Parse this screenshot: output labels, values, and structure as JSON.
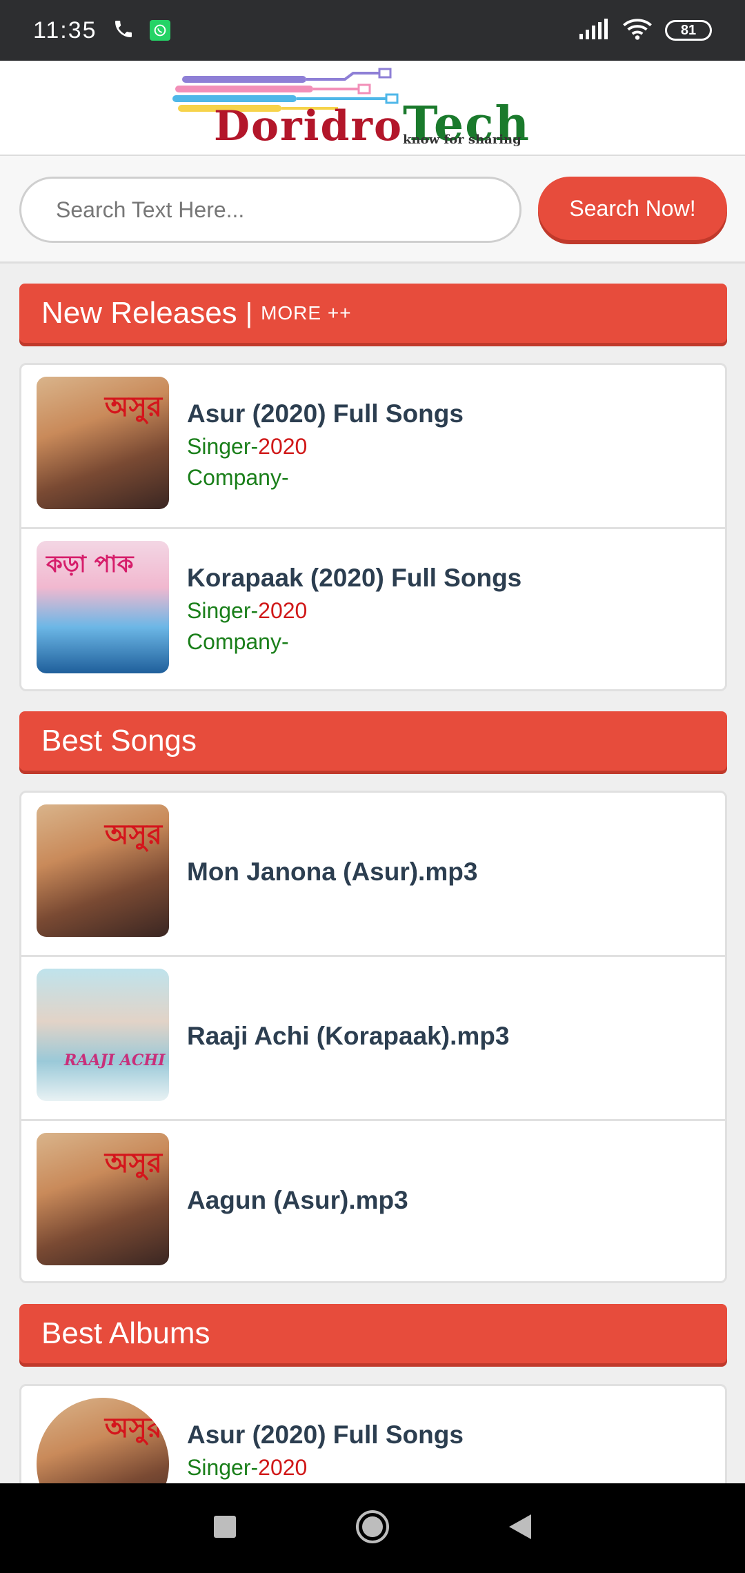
{
  "status": {
    "time": "11:35",
    "battery": "81"
  },
  "header": {
    "logo_word_1": "Doridro",
    "logo_word_2": "Tech",
    "logo_tagline": "know for sharing"
  },
  "search": {
    "placeholder": "Search Text Here...",
    "button_label": "Search Now!"
  },
  "sections": {
    "new_releases": {
      "title": "New Releases",
      "divider": "|",
      "more": "MORE ++",
      "items": [
        {
          "title": "Asur (2020) Full Songs",
          "singer_label": "Singer-",
          "singer_value": "2020",
          "company_label": "Company-"
        },
        {
          "title": "Korapaak (2020) Full Songs",
          "singer_label": "Singer-",
          "singer_value": "2020",
          "company_label": "Company-"
        }
      ]
    },
    "best_songs": {
      "title": "Best Songs",
      "items": [
        {
          "title": "Mon Janona (Asur).mp3"
        },
        {
          "title": "Raaji Achi (Korapaak).mp3"
        },
        {
          "title": "Aagun (Asur).mp3"
        }
      ]
    },
    "best_albums": {
      "title": "Best Albums",
      "items": [
        {
          "title": "Asur (2020) Full Songs",
          "singer_label": "Singer-",
          "singer_value": "2020"
        }
      ]
    }
  },
  "colors": {
    "accent": "#e74c3c",
    "status_bar": "#2d2e30",
    "title_text": "#2c3e50",
    "green_text": "#1a7f1a",
    "red_text": "#d01818"
  }
}
